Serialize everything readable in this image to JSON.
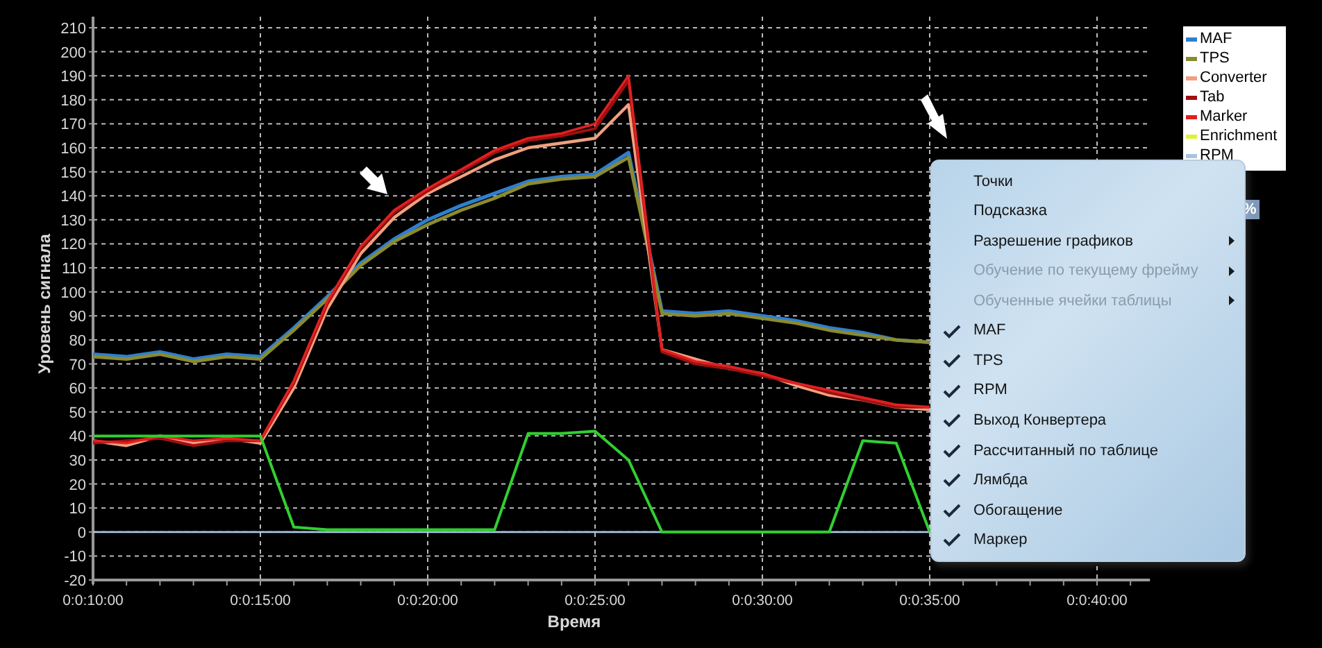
{
  "chart": {
    "chart_data": {
      "type": "line",
      "xlabel": "Время",
      "ylabel": "Уровень сигнала",
      "categories": [
        "0:0:10:00",
        null,
        null,
        null,
        null,
        "0:0:15:00",
        null,
        null,
        null,
        null,
        "0:0:20:00",
        null,
        null,
        null,
        null,
        "0:0:25:00",
        null,
        null,
        null,
        null,
        "0:0:30:00",
        null,
        null,
        null,
        null,
        "0:0:35:00",
        null,
        null,
        null,
        null,
        "0:0:40:00",
        null
      ],
      "ylim": [
        -20,
        210
      ],
      "grid": true,
      "yticks": [
        -20,
        -10,
        0,
        10,
        20,
        30,
        40,
        50,
        60,
        70,
        80,
        90,
        100,
        110,
        120,
        130,
        140,
        150,
        160,
        170,
        180,
        190,
        200,
        210
      ],
      "series": [
        {
          "name": "MAF",
          "color": "#2f7fd0",
          "values": [
            74,
            73,
            75,
            72,
            74,
            73,
            85,
            98,
            112,
            122,
            130,
            136,
            141,
            146,
            148,
            149,
            158,
            92,
            91,
            92,
            90,
            88,
            85,
            83,
            80,
            79,
            null,
            null,
            null,
            null,
            null,
            null
          ]
        },
        {
          "name": "TPS",
          "color": "#8a8a30",
          "values": [
            73,
            72,
            74,
            71,
            73,
            72,
            84,
            97,
            111,
            121,
            128,
            134,
            139,
            145,
            147,
            148,
            156,
            91,
            90,
            91,
            89,
            87,
            84,
            82,
            80,
            79,
            null,
            null,
            null,
            null,
            null,
            null
          ]
        },
        {
          "name": "Converter",
          "color": "#f0a080",
          "values": [
            38,
            36,
            40,
            37,
            39,
            37,
            60,
            93,
            116,
            131,
            141,
            148,
            155,
            160,
            162,
            164,
            178,
            76,
            72,
            68,
            66,
            61,
            57,
            55,
            52,
            51,
            null,
            null,
            null,
            null,
            null,
            null
          ]
        },
        {
          "name": "Tab",
          "color": "#a01010",
          "values": [
            37,
            38,
            39,
            36,
            38,
            38,
            62,
            95,
            118,
            133,
            142,
            150,
            158,
            163,
            165,
            168,
            188,
            75,
            70,
            68,
            65,
            62,
            58,
            55,
            52,
            52,
            null,
            null,
            null,
            null,
            null,
            null
          ]
        },
        {
          "name": "Marker",
          "color": "#e02020",
          "values": [
            38,
            37,
            40,
            38,
            39,
            38,
            63,
            96,
            119,
            134,
            143,
            151,
            159,
            164,
            166,
            170,
            190,
            76,
            71,
            69,
            66,
            62,
            59,
            56,
            53,
            52,
            null,
            null,
            null,
            null,
            null,
            null
          ]
        },
        {
          "name": "Enrichment",
          "color": "#e0f040",
          "values": [
            null,
            null,
            null,
            null,
            null,
            null,
            null,
            null,
            null,
            null,
            null,
            null,
            null,
            null,
            null,
            null,
            null,
            null,
            null,
            null,
            null,
            null,
            null,
            null,
            null,
            null,
            null,
            null,
            null,
            null,
            null,
            null
          ]
        },
        {
          "name": "RPM",
          "color": "#a8c4e0",
          "values": [
            0,
            0,
            0,
            0,
            0,
            0,
            0,
            0,
            0,
            0,
            0,
            0,
            0,
            0,
            0,
            0,
            0,
            0,
            0,
            0,
            0,
            0,
            0,
            0,
            0,
            0,
            null,
            null,
            null,
            null,
            null,
            null
          ]
        },
        {
          "color": "#30d030",
          "values": [
            40,
            40,
            40,
            40,
            40,
            40,
            2,
            1,
            1,
            1,
            1,
            1,
            1,
            41,
            41,
            42,
            30,
            0,
            0,
            0,
            0,
            0,
            0,
            38,
            37,
            0,
            null,
            null,
            null,
            null,
            null,
            null
          ]
        }
      ]
    }
  },
  "partial_label": "%",
  "context_menu": {
    "items": [
      {
        "label": "Точки",
        "kind": "item",
        "disabled": false,
        "checked": false
      },
      {
        "label": "Подсказка",
        "kind": "item",
        "disabled": false,
        "checked": false
      },
      {
        "label": "Разрешение графиков",
        "kind": "submenu",
        "disabled": false,
        "checked": false
      },
      {
        "label": "Обучение по текущему фрейму",
        "kind": "submenu",
        "disabled": true,
        "checked": false
      },
      {
        "label": "Обученные ячейки таблицы",
        "kind": "submenu",
        "disabled": true,
        "checked": false
      },
      {
        "label": "MAF",
        "kind": "item",
        "disabled": false,
        "checked": true
      },
      {
        "label": "TPS",
        "kind": "item",
        "disabled": false,
        "checked": true
      },
      {
        "label": "RPM",
        "kind": "item",
        "disabled": false,
        "checked": true
      },
      {
        "label": "Выход Конвертера",
        "kind": "item",
        "disabled": false,
        "checked": true
      },
      {
        "label": "Рассчитанный по таблице",
        "kind": "item",
        "disabled": false,
        "checked": true
      },
      {
        "label": "Лямбда",
        "kind": "item",
        "disabled": false,
        "checked": true
      },
      {
        "label": "Обогащение",
        "kind": "item",
        "disabled": false,
        "checked": true
      },
      {
        "label": "Маркер",
        "kind": "item",
        "disabled": false,
        "checked": true
      }
    ]
  }
}
